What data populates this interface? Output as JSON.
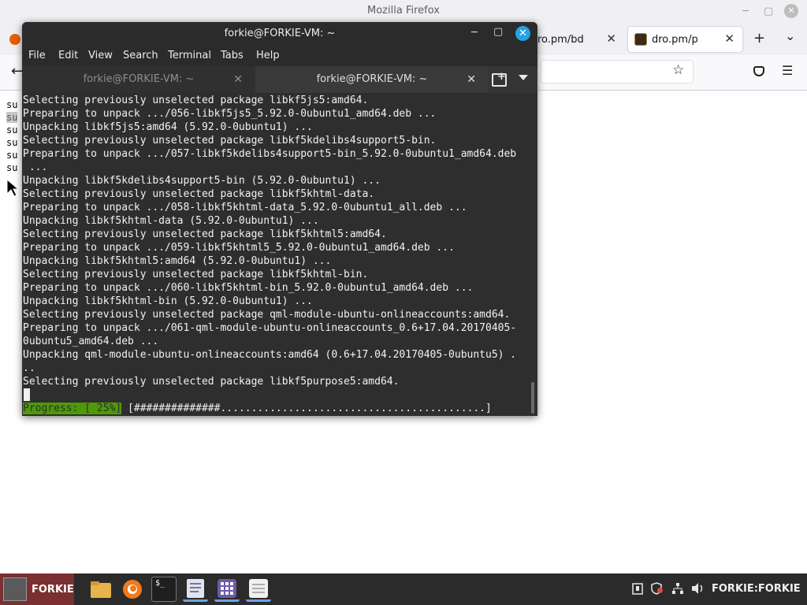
{
  "firefox": {
    "window_title": "Mozilla Firefox",
    "tabs": [
      {
        "label": "ro.pm/bd",
        "close": "✕"
      },
      {
        "label": "dro.pm/p",
        "close": "✕"
      }
    ],
    "new_tab": "+",
    "list_tabs": "⌄",
    "back": "←",
    "bookmark": "☆",
    "pocket": "pocket",
    "menu": "☰",
    "content_lines": [
      "su",
      "su",
      "su",
      "su",
      "su",
      "su"
    ]
  },
  "terminal": {
    "title": "forkie@FORKIE-VM: ~",
    "menu": [
      "File",
      "Edit",
      "View",
      "Search",
      "Terminal",
      "Tabs",
      "Help"
    ],
    "tabs": [
      {
        "label": "forkie@FORKIE-VM: ~",
        "close": "✕"
      },
      {
        "label": "forkie@FORKIE-VM: ~",
        "close": "✕"
      }
    ],
    "output": [
      "Selecting previously unselected package libkf5js5:amd64.",
      "Preparing to unpack .../056-libkf5js5_5.92.0-0ubuntu1_amd64.deb ...",
      "Unpacking libkf5js5:amd64 (5.92.0-0ubuntu1) ...",
      "Selecting previously unselected package libkf5kdelibs4support5-bin.",
      "Preparing to unpack .../057-libkf5kdelibs4support5-bin_5.92.0-0ubuntu1_amd64.deb",
      " ...",
      "Unpacking libkf5kdelibs4support5-bin (5.92.0-0ubuntu1) ...",
      "Selecting previously unselected package libkf5khtml-data.",
      "Preparing to unpack .../058-libkf5khtml-data_5.92.0-0ubuntu1_all.deb ...",
      "Unpacking libkf5khtml-data (5.92.0-0ubuntu1) ...",
      "Selecting previously unselected package libkf5khtml5:amd64.",
      "Preparing to unpack .../059-libkf5khtml5_5.92.0-0ubuntu1_amd64.deb ...",
      "Unpacking libkf5khtml5:amd64 (5.92.0-0ubuntu1) ...",
      "Selecting previously unselected package libkf5khtml-bin.",
      "Preparing to unpack .../060-libkf5khtml-bin_5.92.0-0ubuntu1_amd64.deb ...",
      "Unpacking libkf5khtml-bin (5.92.0-0ubuntu1) ...",
      "Selecting previously unselected package qml-module-ubuntu-onlineaccounts:amd64.",
      "Preparing to unpack .../061-qml-module-ubuntu-onlineaccounts_0.6+17.04.20170405-",
      "0ubuntu5_amd64.deb ...",
      "Unpacking qml-module-ubuntu-onlineaccounts:amd64 (0.6+17.04.20170405-0ubuntu5) .",
      "..",
      "Selecting previously unselected package libkf5purpose5:amd64."
    ],
    "progress": {
      "label": "Progress: [ 25%]",
      "bar": " [##############...........................................]",
      "percent": 25
    }
  },
  "taskbar": {
    "start_label": "FORKIE",
    "user_label": "FORKIE:FORKIE",
    "apps": [
      "files-icon",
      "firefox-icon",
      "terminal-icon",
      "text-editor-icon",
      "app-grid-icon",
      "notes-icon"
    ],
    "tray": [
      "clipboard-icon",
      "shield-icon",
      "update-icon",
      "network-icon",
      "volume-icon"
    ],
    "colors": {
      "start_bg": "#7a3030",
      "active_indicator": "#6aa5e8"
    }
  },
  "colors": {
    "terminal_bg": "#2e2e2e",
    "progress_green": "#4e9a06",
    "close_button_blue": "#23a3e2"
  }
}
